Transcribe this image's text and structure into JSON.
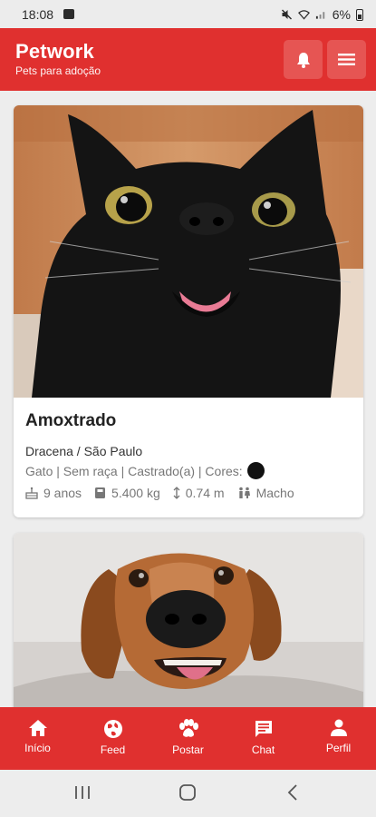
{
  "status": {
    "time": "18:08",
    "battery": "6%"
  },
  "app": {
    "title": "Petwork",
    "subtitle": "Pets para adoção"
  },
  "header": {
    "notifications_icon": "bell-icon",
    "menu_icon": "hamburger-icon"
  },
  "pets": [
    {
      "name": "Amoxtrado",
      "location": "Dracena / São Paulo",
      "traits": "Gato | Sem raça | Castrado(a) | Cores:",
      "color": "#111111",
      "age": "9 anos",
      "weight": "5.400 kg",
      "height": "0.74 m",
      "sex": "Macho"
    },
    {
      "name": "",
      "image": "dog-photo"
    }
  ],
  "nav": {
    "items": [
      {
        "label": "Início",
        "icon": "home-icon"
      },
      {
        "label": "Feed",
        "icon": "globe-icon"
      },
      {
        "label": "Postar",
        "icon": "paw-icon"
      },
      {
        "label": "Chat",
        "icon": "chat-icon"
      },
      {
        "label": "Perfil",
        "icon": "person-icon"
      }
    ]
  },
  "colors": {
    "primary": "#e0302f",
    "button": "#e65553"
  }
}
